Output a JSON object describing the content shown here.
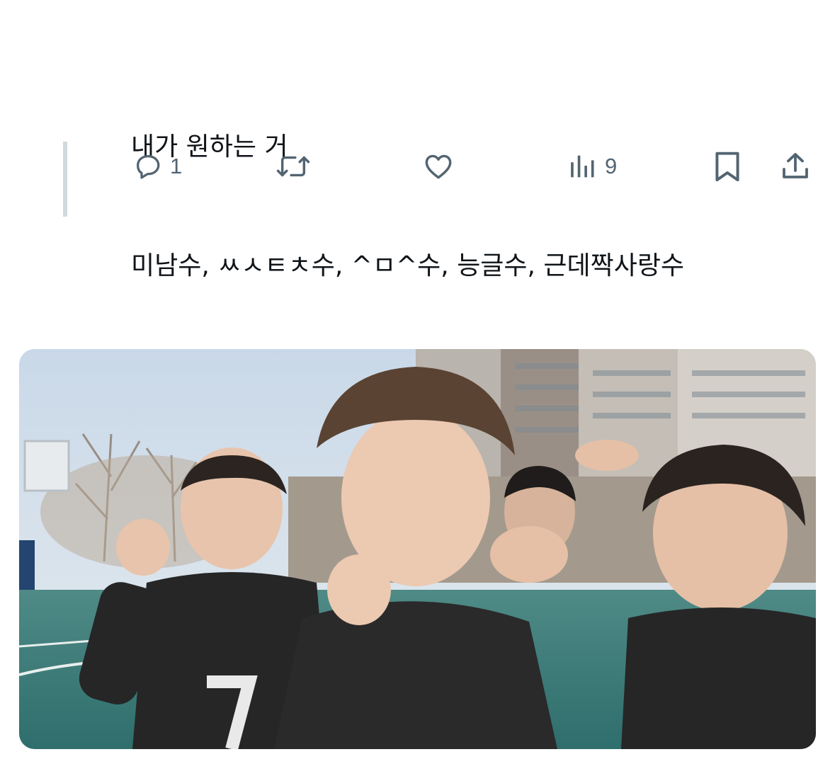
{
  "tweet": {
    "lines": [
      "내가 원하는 거",
      "미남수, ㅆㅅㅌㅊ수, ^ㅁ^수, 능글수, 근데짝사랑수"
    ]
  },
  "actions": {
    "reply_count": "1",
    "retweet_count": "",
    "like_count": "",
    "views_count": "9"
  },
  "icons": {
    "reply": "reply-icon",
    "retweet": "retweet-icon",
    "like": "heart-icon",
    "views": "views-chart-icon",
    "bookmark": "bookmark-icon",
    "share": "share-icon"
  },
  "colors": {
    "text": "#0f1419",
    "icon": "#536471",
    "thread_line": "#cfd9de"
  }
}
